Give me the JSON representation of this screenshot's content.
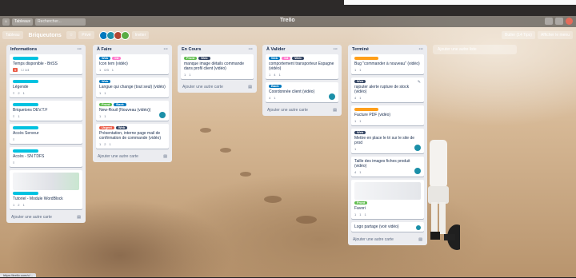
{
  "header": {
    "home": "⌂",
    "boards_label": "Tableaux",
    "search_placeholder": "Rechercher...",
    "logo": "Trello",
    "notif": "!"
  },
  "board": {
    "menu_label": "Tableau",
    "title": "Briqueutons",
    "visibility": "Privé",
    "invite": "Inviter",
    "butler": "Butler (14 Tips)",
    "menu": "Afficher le menu"
  },
  "lists": [
    {
      "title": "Informations",
      "add": "Ajouter une autre carte",
      "cards": [
        {
          "labels": [
            {
              "text": "",
              "color": "#00c2e0"
            }
          ],
          "title": "Temps disponible - BriSS",
          "badges": [
            "5",
            "☐ 1/4"
          ]
        },
        {
          "labels": [
            {
              "text": "",
              "color": "#00c2e0"
            }
          ],
          "title": "Légende",
          "badges": [
            "≡",
            "2",
            "1"
          ]
        },
        {
          "labels": [
            {
              "text": "",
              "color": "#00c2e0"
            }
          ],
          "title": "Briquetons DEV.T.F",
          "badges": [
            "≡",
            "1"
          ]
        },
        {
          "labels": [
            {
              "text": "",
              "color": "#00c2e0"
            }
          ],
          "title": "Accès Serveur",
          "badges": [
            "≡"
          ]
        },
        {
          "labels": [
            {
              "text": "",
              "color": "#00c2e0"
            }
          ],
          "title": "Accès - SN TDFS",
          "badges": [
            "≡"
          ]
        },
        {
          "labels": [
            {
              "text": "",
              "color": "#00c2e0"
            }
          ],
          "title": "Tutoriel - Module WordBlock",
          "badges": [
            "1",
            "2",
            "1"
          ],
          "image": true
        }
      ]
    },
    {
      "title": "À Faire",
      "add": "Ajouter une autre carte",
      "cards": [
        {
          "labels": [
            {
              "text": "Web",
              "color": "#0079bf"
            },
            {
              "text": "Int",
              "color": "#ff78cb"
            }
          ],
          "title": "Icon tem (vidéo)",
          "badges": [
            "1",
            "0/3",
            "1"
          ]
        },
        {
          "labels": [
            {
              "text": "Web",
              "color": "#0079bf"
            }
          ],
          "title": "Langue qui change (tout seul) (vidéo)",
          "badges": [
            "1",
            "1"
          ]
        },
        {
          "labels": [
            {
              "text": "Front",
              "color": "#61bd4f"
            },
            {
              "text": "Back",
              "color": "#0079bf"
            }
          ],
          "title": "New-Rouil (Nouveau (vidéo))",
          "badges": [
            "1",
            "1"
          ]
        },
        {
          "labels": [
            {
              "text": "Urgent",
              "color": "#eb5a46"
            },
            {
              "text": "Web",
              "color": "#344563"
            }
          ],
          "title": "Présentation, interne page mail de confirmation de commande (vidéo)",
          "badges": [
            "1",
            "2",
            "1"
          ]
        }
      ]
    },
    {
      "title": "En Cours",
      "add": "Ajouter une autre carte",
      "cards": [
        {
          "labels": [
            {
              "text": "Front",
              "color": "#61bd4f"
            },
            {
              "text": "Web",
              "color": "#344563"
            }
          ],
          "title": "manque image détails commande dans profil client (vidéo)",
          "badges": [
            "1",
            "1"
          ]
        }
      ]
    },
    {
      "title": "À Valider",
      "add": "Ajouter une autre carte",
      "cards": [
        {
          "labels": [
            {
              "text": "Web",
              "color": "#0079bf"
            },
            {
              "text": "Int",
              "color": "#ff78cb"
            },
            {
              "text": "Web",
              "color": "#344563"
            }
          ],
          "title": "comportement transporteur Espagne (vidéo)",
          "badges": [
            "1",
            "4",
            "1"
          ]
        },
        {
          "labels": [
            {
              "text": "Back",
              "color": "#0079bf"
            }
          ],
          "title": "Coordonnée client (vidéo)",
          "badges": [
            "4",
            "1"
          ]
        }
      ]
    },
    {
      "title": "Terminé",
      "add": "Ajouter une autre carte",
      "cards": [
        {
          "labels": [
            {
              "text": "",
              "color": "#ff9f1a"
            }
          ],
          "title": "Bug \"commander à nouveau\" (vidéo)",
          "badges": [
            "1",
            "1"
          ]
        },
        {
          "labels": [
            {
              "text": "Web",
              "color": "#344563"
            }
          ],
          "title": "rajouter alerte rupture de stock (vidéo)",
          "badges": [
            "4",
            "1"
          ]
        },
        {
          "labels": [
            {
              "text": "",
              "color": "#ff9f1a"
            }
          ],
          "title": "Facture PDF (vidéo)",
          "badges": [
            "1",
            "1"
          ]
        },
        {
          "labels": [
            {
              "text": "Web",
              "color": "#344563"
            }
          ],
          "title": "Mettre en place le tri sur le site de prod",
          "badges": [
            "1"
          ]
        },
        {
          "labels": [],
          "title": "Taille des images fiches produit (vidéo)",
          "badges": [
            "4",
            "1"
          ]
        },
        {
          "labels": [
            {
              "text": "Front",
              "color": "#61bd4f"
            }
          ],
          "title": "Favori",
          "badges": [
            "1",
            "1",
            "1"
          ],
          "image": true
        },
        {
          "labels": [],
          "title": "Logo partage (voir vidéo)",
          "badges": []
        }
      ]
    }
  ],
  "add_list": "Ajouter une autre liste",
  "status_url": "https://trello.com/c/...",
  "colors": {
    "member1": "#0079bf",
    "member2": "#1b8fa8",
    "member3": "#b04632",
    "member4": "#5aac44"
  }
}
